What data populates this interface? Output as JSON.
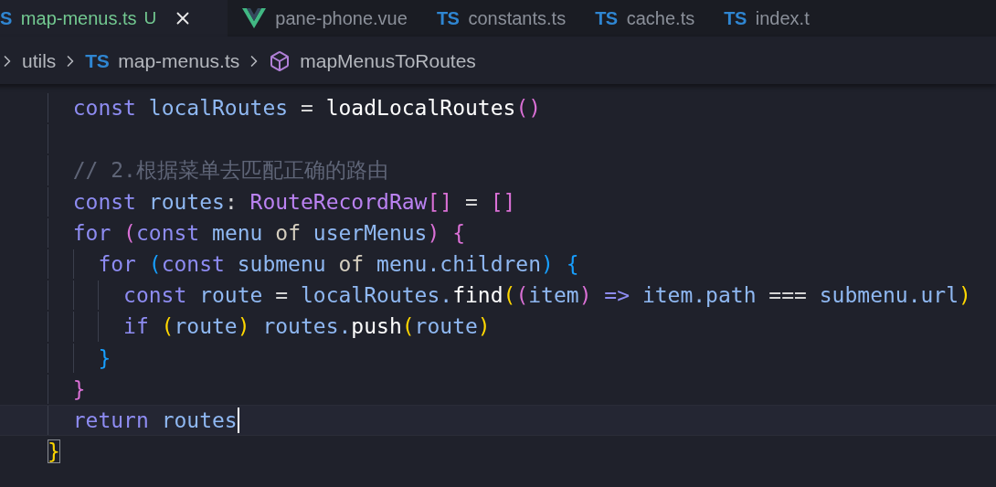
{
  "tabs": [
    {
      "kind": "ts",
      "icon_text": "S",
      "label": "map-menus.ts",
      "status": "U",
      "selected": true
    },
    {
      "kind": "vue",
      "label": "pane-phone.vue",
      "selected": false
    },
    {
      "kind": "ts",
      "icon_text": "TS",
      "label": "constants.ts",
      "selected": false
    },
    {
      "kind": "ts",
      "icon_text": "TS",
      "label": "cache.ts",
      "selected": false
    },
    {
      "kind": "ts",
      "icon_text": "TS",
      "label": "index.t",
      "selected": false
    }
  ],
  "breadcrumb": [
    {
      "kind": "folder",
      "label": "utils"
    },
    {
      "kind": "file",
      "icon_text": "TS",
      "label": "map-menus.ts"
    },
    {
      "kind": "symbol",
      "label": "mapMenusToRoutes"
    }
  ],
  "lines": [
    {
      "children": [
        {
          "cursor": false,
          "tokens": [
            {
              "text": "const ",
              "kind": "kw"
            },
            {
              "text": "localRoutes ",
              "kind": "var"
            },
            {
              "text": "= ",
              "kind": "op"
            },
            {
              "text": "loadLocalRoutes",
              "kind": "fn"
            },
            {
              "text": "()",
              "kind": "b2"
            }
          ]
        },
        {
          "cursor": false
        },
        {
          "cursor": false,
          "tokens": [
            {
              "text": "// 2.根据菜单去匹配正确的路由",
              "kind": "cm"
            }
          ]
        },
        {
          "cursor": false,
          "tokens": [
            {
              "text": "const ",
              "kind": "kw"
            },
            {
              "text": "routes",
              "kind": "var"
            },
            {
              "text": ": ",
              "kind": "op"
            },
            {
              "text": "RouteRecordRaw",
              "kind": "type"
            },
            {
              "text": "[]",
              "kind": "b2"
            },
            {
              "text": " = ",
              "kind": "op"
            },
            {
              "text": "[]",
              "kind": "b2"
            }
          ]
        },
        {
          "cursor": false,
          "tokens": [
            {
              "text": "for ",
              "kind": "kw"
            },
            {
              "text": "(",
              "kind": "b2"
            },
            {
              "text": "const ",
              "kind": "kw"
            },
            {
              "text": "menu ",
              "kind": "var"
            },
            {
              "text": "of ",
              "kind": "ctl"
            },
            {
              "text": "userMenus",
              "kind": "var"
            },
            {
              "text": ") {",
              "kind": "b2"
            }
          ],
          "children": [
            {
              "cursor": false,
              "tokens": [
                {
                  "text": "for ",
                  "kind": "kw"
                },
                {
                  "text": "(",
                  "kind": "b3"
                },
                {
                  "text": "const ",
                  "kind": "kw"
                },
                {
                  "text": "submenu ",
                  "kind": "var"
                },
                {
                  "text": "of ",
                  "kind": "ctl"
                },
                {
                  "text": "menu.children",
                  "kind": "var"
                },
                {
                  "text": ") {",
                  "kind": "b3"
                }
              ],
              "children": [
                {
                  "cursor": false,
                  "tokens": [
                    {
                      "text": "const ",
                      "kind": "kw"
                    },
                    {
                      "text": "route ",
                      "kind": "var"
                    },
                    {
                      "text": "= ",
                      "kind": "op"
                    },
                    {
                      "text": "localRoutes.",
                      "kind": "var"
                    },
                    {
                      "text": "find",
                      "kind": "fn"
                    },
                    {
                      "text": "(",
                      "kind": "b1"
                    },
                    {
                      "text": "(",
                      "kind": "b2"
                    },
                    {
                      "text": "item",
                      "kind": "var"
                    },
                    {
                      "text": ")",
                      "kind": "b2"
                    },
                    {
                      "text": " => ",
                      "kind": "kw"
                    },
                    {
                      "text": "item.path ",
                      "kind": "var"
                    },
                    {
                      "text": "=== ",
                      "kind": "op"
                    },
                    {
                      "text": "submenu.url",
                      "kind": "var"
                    },
                    {
                      "text": ")",
                      "kind": "b1"
                    }
                  ]
                },
                {
                  "cursor": false,
                  "tokens": [
                    {
                      "text": "if ",
                      "kind": "kw"
                    },
                    {
                      "text": "(",
                      "kind": "b1"
                    },
                    {
                      "text": "route",
                      "kind": "var"
                    },
                    {
                      "text": ") ",
                      "kind": "b1"
                    },
                    {
                      "text": "routes.",
                      "kind": "var"
                    },
                    {
                      "text": "push",
                      "kind": "fn"
                    },
                    {
                      "text": "(",
                      "kind": "b1"
                    },
                    {
                      "text": "route",
                      "kind": "var"
                    },
                    {
                      "text": ")",
                      "kind": "b1"
                    }
                  ]
                }
              ]
            },
            {
              "cursor": false,
              "tokens": [
                {
                  "text": "}",
                  "kind": "b3"
                }
              ]
            }
          ]
        },
        {
          "cursor": false,
          "tokens": [
            {
              "text": "}",
              "kind": "b2"
            }
          ]
        },
        {
          "cursor": true,
          "tokens": [
            {
              "text": "return ",
              "kind": "kw"
            },
            {
              "text": "routes",
              "kind": "var"
            }
          ]
        }
      ]
    },
    {
      "cursor": false,
      "tokens": [
        {
          "text": "}",
          "kind": "b1",
          "matched": true
        }
      ]
    }
  ]
}
